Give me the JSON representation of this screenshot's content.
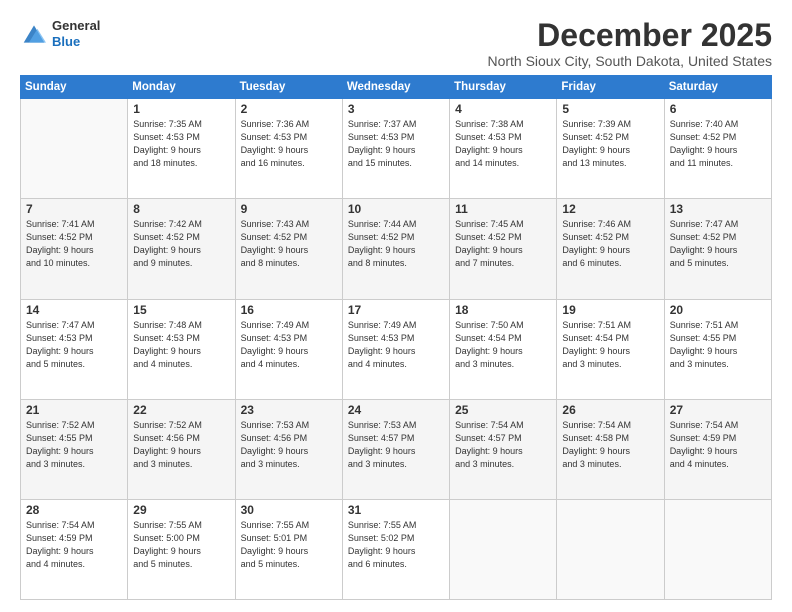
{
  "header": {
    "logo_general": "General",
    "logo_blue": "Blue",
    "month_title": "December 2025",
    "subtitle": "North Sioux City, South Dakota, United States"
  },
  "days_of_week": [
    "Sunday",
    "Monday",
    "Tuesday",
    "Wednesday",
    "Thursday",
    "Friday",
    "Saturday"
  ],
  "weeks": [
    [
      {
        "day": "",
        "info": ""
      },
      {
        "day": "1",
        "info": "Sunrise: 7:35 AM\nSunset: 4:53 PM\nDaylight: 9 hours\nand 18 minutes."
      },
      {
        "day": "2",
        "info": "Sunrise: 7:36 AM\nSunset: 4:53 PM\nDaylight: 9 hours\nand 16 minutes."
      },
      {
        "day": "3",
        "info": "Sunrise: 7:37 AM\nSunset: 4:53 PM\nDaylight: 9 hours\nand 15 minutes."
      },
      {
        "day": "4",
        "info": "Sunrise: 7:38 AM\nSunset: 4:53 PM\nDaylight: 9 hours\nand 14 minutes."
      },
      {
        "day": "5",
        "info": "Sunrise: 7:39 AM\nSunset: 4:52 PM\nDaylight: 9 hours\nand 13 minutes."
      },
      {
        "day": "6",
        "info": "Sunrise: 7:40 AM\nSunset: 4:52 PM\nDaylight: 9 hours\nand 11 minutes."
      }
    ],
    [
      {
        "day": "7",
        "info": "Sunrise: 7:41 AM\nSunset: 4:52 PM\nDaylight: 9 hours\nand 10 minutes."
      },
      {
        "day": "8",
        "info": "Sunrise: 7:42 AM\nSunset: 4:52 PM\nDaylight: 9 hours\nand 9 minutes."
      },
      {
        "day": "9",
        "info": "Sunrise: 7:43 AM\nSunset: 4:52 PM\nDaylight: 9 hours\nand 8 minutes."
      },
      {
        "day": "10",
        "info": "Sunrise: 7:44 AM\nSunset: 4:52 PM\nDaylight: 9 hours\nand 8 minutes."
      },
      {
        "day": "11",
        "info": "Sunrise: 7:45 AM\nSunset: 4:52 PM\nDaylight: 9 hours\nand 7 minutes."
      },
      {
        "day": "12",
        "info": "Sunrise: 7:46 AM\nSunset: 4:52 PM\nDaylight: 9 hours\nand 6 minutes."
      },
      {
        "day": "13",
        "info": "Sunrise: 7:47 AM\nSunset: 4:52 PM\nDaylight: 9 hours\nand 5 minutes."
      }
    ],
    [
      {
        "day": "14",
        "info": "Sunrise: 7:47 AM\nSunset: 4:53 PM\nDaylight: 9 hours\nand 5 minutes."
      },
      {
        "day": "15",
        "info": "Sunrise: 7:48 AM\nSunset: 4:53 PM\nDaylight: 9 hours\nand 4 minutes."
      },
      {
        "day": "16",
        "info": "Sunrise: 7:49 AM\nSunset: 4:53 PM\nDaylight: 9 hours\nand 4 minutes."
      },
      {
        "day": "17",
        "info": "Sunrise: 7:49 AM\nSunset: 4:53 PM\nDaylight: 9 hours\nand 4 minutes."
      },
      {
        "day": "18",
        "info": "Sunrise: 7:50 AM\nSunset: 4:54 PM\nDaylight: 9 hours\nand 3 minutes."
      },
      {
        "day": "19",
        "info": "Sunrise: 7:51 AM\nSunset: 4:54 PM\nDaylight: 9 hours\nand 3 minutes."
      },
      {
        "day": "20",
        "info": "Sunrise: 7:51 AM\nSunset: 4:55 PM\nDaylight: 9 hours\nand 3 minutes."
      }
    ],
    [
      {
        "day": "21",
        "info": "Sunrise: 7:52 AM\nSunset: 4:55 PM\nDaylight: 9 hours\nand 3 minutes."
      },
      {
        "day": "22",
        "info": "Sunrise: 7:52 AM\nSunset: 4:56 PM\nDaylight: 9 hours\nand 3 minutes."
      },
      {
        "day": "23",
        "info": "Sunrise: 7:53 AM\nSunset: 4:56 PM\nDaylight: 9 hours\nand 3 minutes."
      },
      {
        "day": "24",
        "info": "Sunrise: 7:53 AM\nSunset: 4:57 PM\nDaylight: 9 hours\nand 3 minutes."
      },
      {
        "day": "25",
        "info": "Sunrise: 7:54 AM\nSunset: 4:57 PM\nDaylight: 9 hours\nand 3 minutes."
      },
      {
        "day": "26",
        "info": "Sunrise: 7:54 AM\nSunset: 4:58 PM\nDaylight: 9 hours\nand 3 minutes."
      },
      {
        "day": "27",
        "info": "Sunrise: 7:54 AM\nSunset: 4:59 PM\nDaylight: 9 hours\nand 4 minutes."
      }
    ],
    [
      {
        "day": "28",
        "info": "Sunrise: 7:54 AM\nSunset: 4:59 PM\nDaylight: 9 hours\nand 4 minutes."
      },
      {
        "day": "29",
        "info": "Sunrise: 7:55 AM\nSunset: 5:00 PM\nDaylight: 9 hours\nand 5 minutes."
      },
      {
        "day": "30",
        "info": "Sunrise: 7:55 AM\nSunset: 5:01 PM\nDaylight: 9 hours\nand 5 minutes."
      },
      {
        "day": "31",
        "info": "Sunrise: 7:55 AM\nSunset: 5:02 PM\nDaylight: 9 hours\nand 6 minutes."
      },
      {
        "day": "",
        "info": ""
      },
      {
        "day": "",
        "info": ""
      },
      {
        "day": "",
        "info": ""
      }
    ]
  ]
}
